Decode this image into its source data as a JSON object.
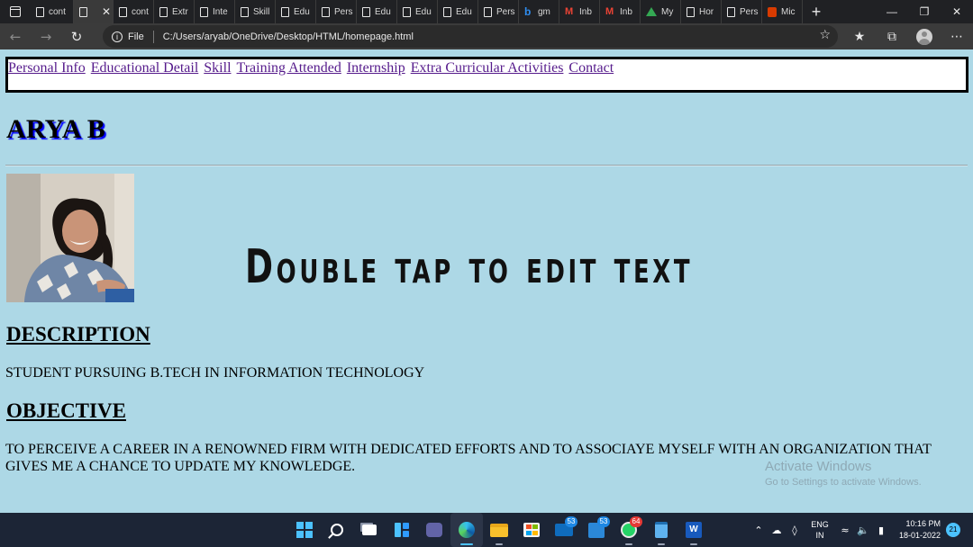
{
  "browser": {
    "tabs": [
      {
        "label": "cont",
        "icon": "page-icon"
      },
      {
        "label": "",
        "icon": "page-icon",
        "active": true
      },
      {
        "label": "cont",
        "icon": "page-icon"
      },
      {
        "label": "Extr",
        "icon": "page-icon"
      },
      {
        "label": "Inte",
        "icon": "page-icon"
      },
      {
        "label": "Skill",
        "icon": "page-icon"
      },
      {
        "label": "Edu",
        "icon": "page-icon"
      },
      {
        "label": "Pers",
        "icon": "page-icon"
      },
      {
        "label": "Edu",
        "icon": "page-icon"
      },
      {
        "label": "Edu",
        "icon": "page-icon"
      },
      {
        "label": "Edu",
        "icon": "page-icon"
      },
      {
        "label": "Pers",
        "icon": "page-icon"
      },
      {
        "label": "gm",
        "icon": "bing-icon"
      },
      {
        "label": "Inb",
        "icon": "gmail-icon"
      },
      {
        "label": "Inb",
        "icon": "gmail-icon"
      },
      {
        "label": "My",
        "icon": "google-drive-icon"
      },
      {
        "label": "Hor",
        "icon": "page-icon"
      },
      {
        "label": "Pers",
        "icon": "page-icon"
      },
      {
        "label": "Mic",
        "icon": "office-icon"
      }
    ],
    "new_tab_label": "+",
    "address_prefix": "File",
    "url": "C:/Users/aryab/OneDrive/Desktop/HTML/homepage.html"
  },
  "page": {
    "nav_links": [
      "Personal Info",
      "Educational Detail",
      "Skill",
      "Training Attended",
      "Internship",
      "Extra Curricular Activities",
      "Contact"
    ],
    "name": "ARYA B",
    "overlay_text": "Double tap to edit text",
    "description_heading": "DESCRIPTION",
    "description_text": "STUDENT PURSUING B.TECH IN INFORMATION TECHNOLOGY",
    "objective_heading": "OBJECTIVE",
    "objective_text": "TO PERCEIVE A CAREER IN A RENOWNED FIRM WITH DEDICATED EFFORTS AND TO ASSOCIAYE MYSELF WITH AN ORGANIZATION THAT GIVES ME A CHANCE TO UPDATE MY KNOWLEDGE.",
    "watermark_title": "Activate Windows",
    "watermark_sub": "Go to Settings to activate Windows."
  },
  "taskbar": {
    "mail_badge": "53",
    "calendar_badge": "53",
    "whatsapp_badge": "64",
    "word_label": "W",
    "lang_line1": "ENG",
    "lang_line2": "IN",
    "time": "10:16 PM",
    "date": "18-01-2022",
    "notification_count": "21"
  },
  "colors": {
    "page_background": "#add8e6",
    "link": "#551a8b",
    "name_shadow": "#0000ff",
    "taskbar": "#1c2536"
  }
}
